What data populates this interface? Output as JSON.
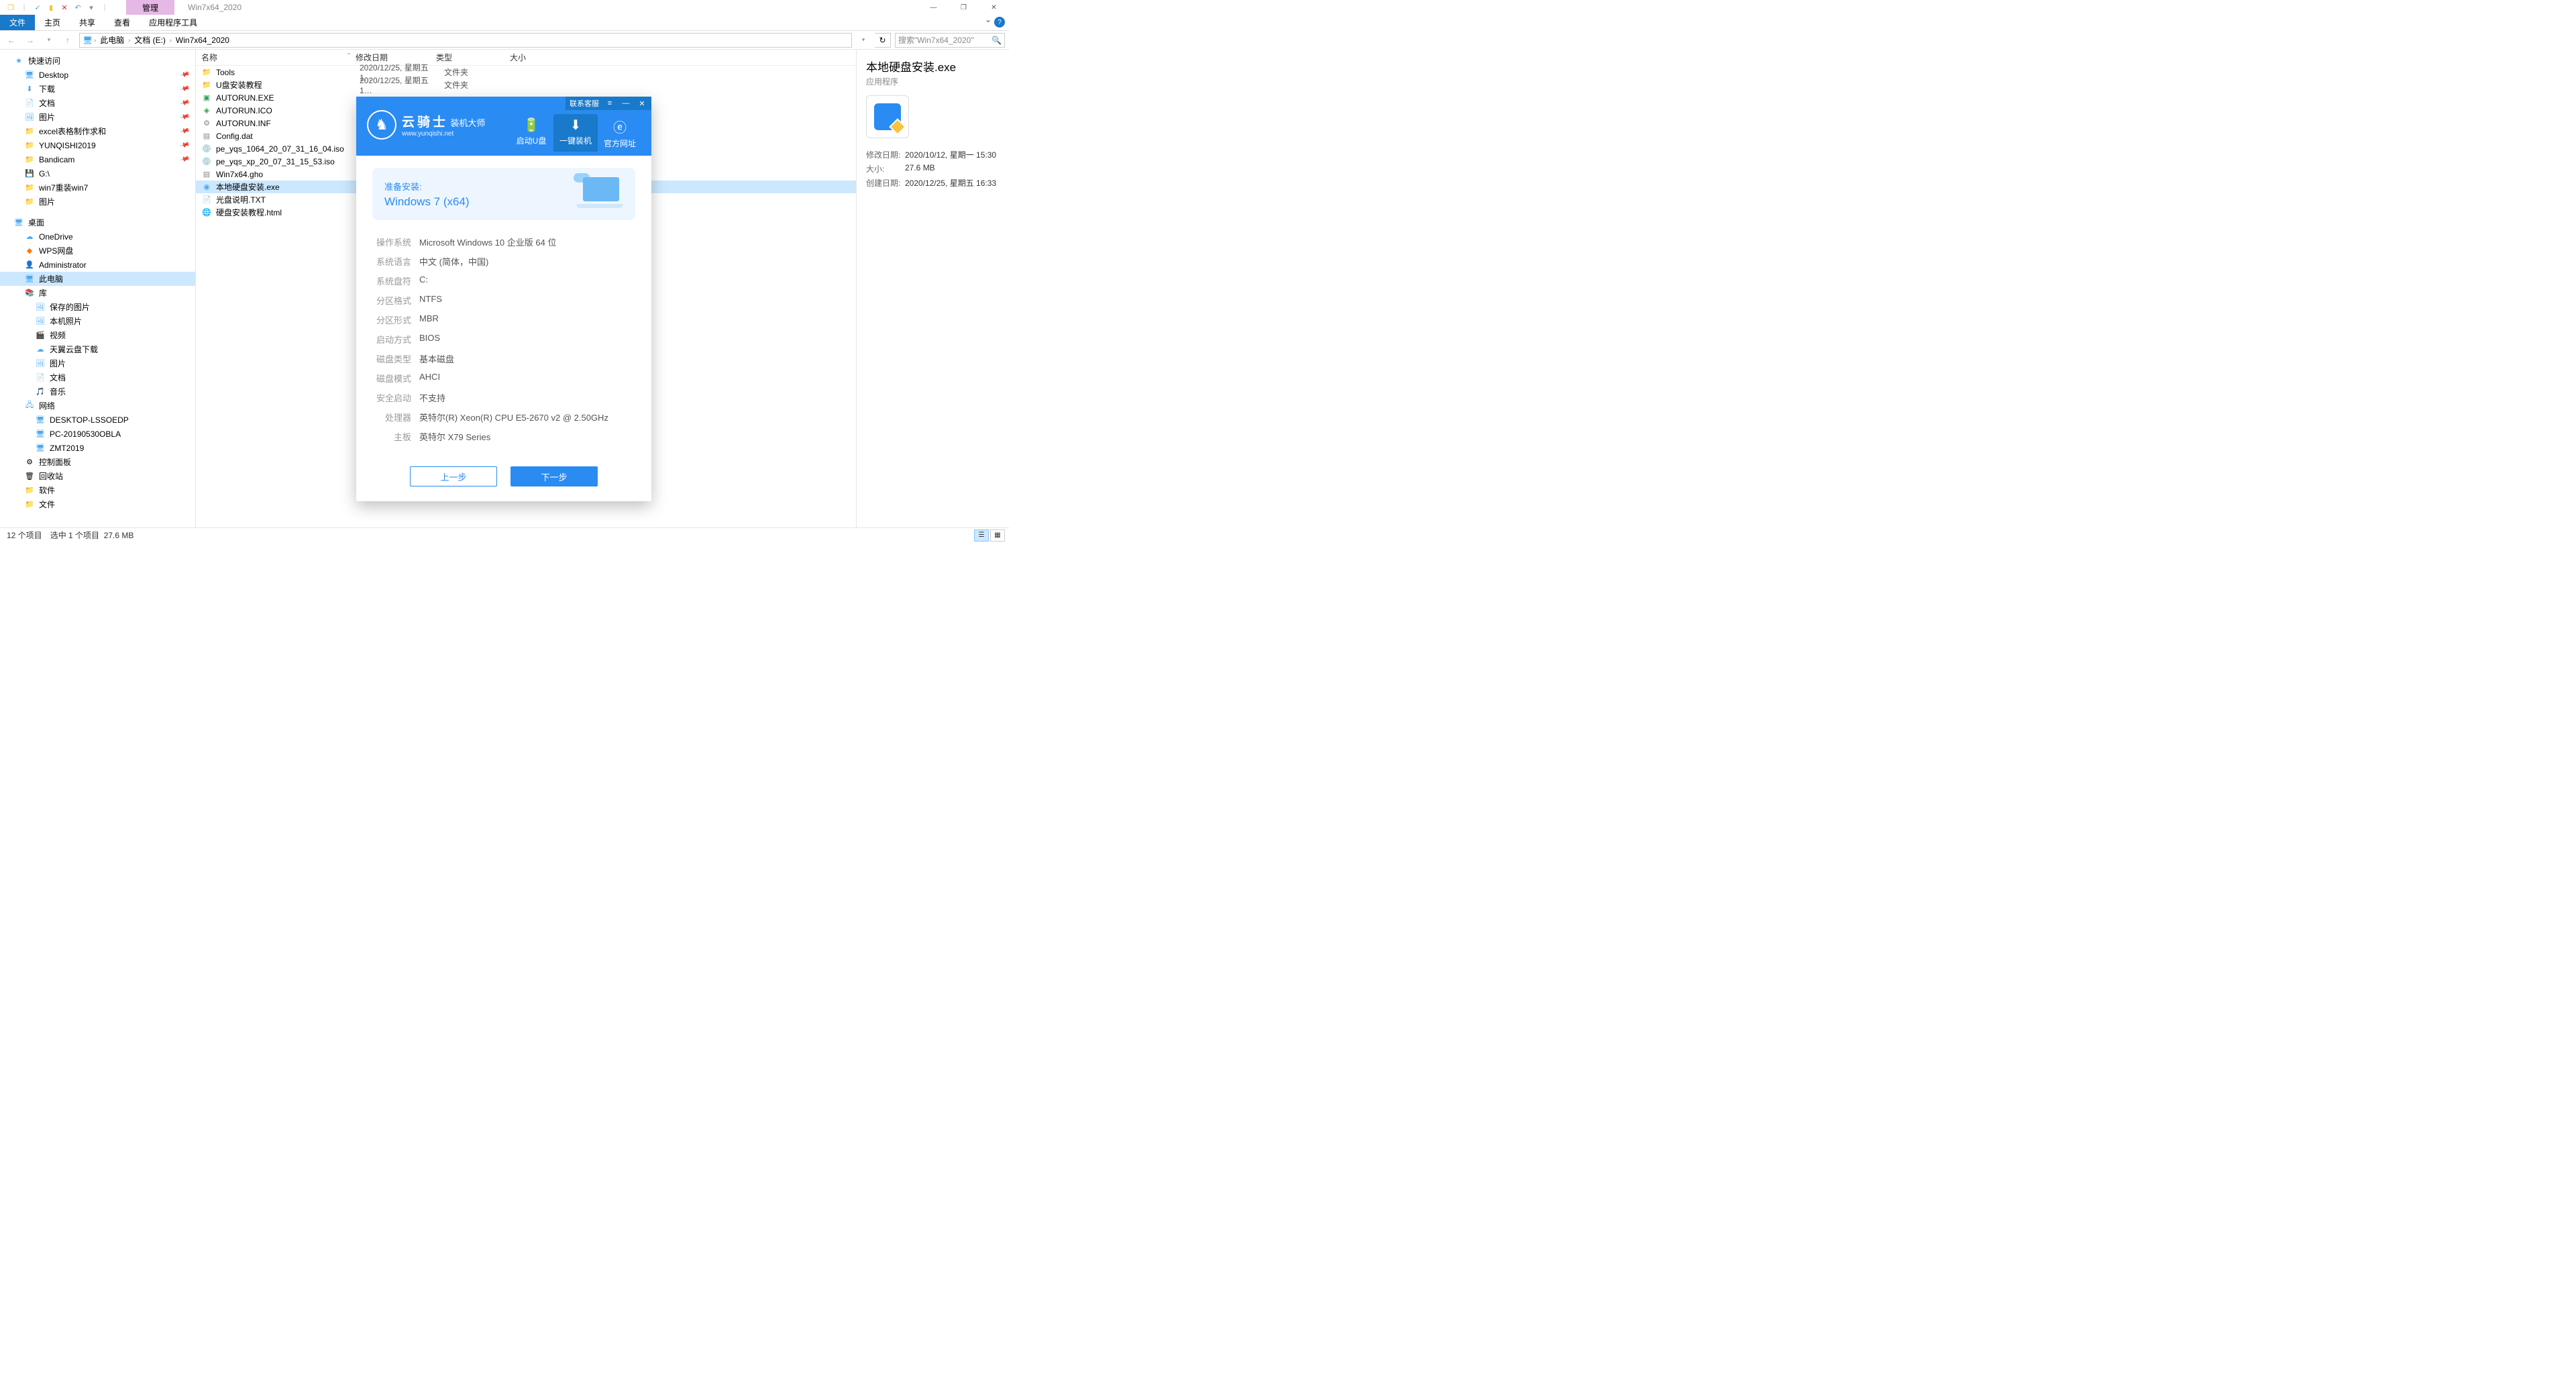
{
  "titlebar": {
    "manage_tab": "管理",
    "window_title": "Win7x64_2020"
  },
  "ribbon": {
    "file": "文件",
    "home": "主页",
    "share": "共享",
    "view": "查看",
    "apptools": "应用程序工具"
  },
  "breadcrumb": {
    "this_pc": "此电脑",
    "docs": "文档 (E:)",
    "folder": "Win7x64_2020"
  },
  "search": {
    "placeholder": "搜索\"Win7x64_2020\""
  },
  "sidebar": {
    "quick_access": "快速访问",
    "desktop": "Desktop",
    "downloads": "下载",
    "documents": "文档",
    "pictures": "图片",
    "excel": "excel表格制作求和",
    "yunqishi": "YUNQISHI2019",
    "bandicam": "Bandicam",
    "gdrive": "G:\\",
    "win7reinstall": "win7重装win7",
    "pictures2": "图片",
    "desktop_group": "桌面",
    "onedrive": "OneDrive",
    "wps": "WPS网盘",
    "admin": "Administrator",
    "this_pc": "此电脑",
    "libraries": "库",
    "saved_pictures": "保存的图片",
    "camera_roll": "本机照片",
    "videos": "视频",
    "tianyi": "天翼云盘下载",
    "pictures3": "图片",
    "documents2": "文档",
    "music": "音乐",
    "network": "网络",
    "pc1": "DESKTOP-LSSOEDP",
    "pc2": "PC-20190530OBLA",
    "pc3": "ZMT2019",
    "control_panel": "控制面板",
    "recycle": "回收站",
    "software": "软件",
    "documents3": "文件"
  },
  "columns": {
    "name": "名称",
    "date": "修改日期",
    "type": "类型",
    "size": "大小"
  },
  "files": [
    {
      "name": "Tools",
      "date": "2020/12/25, 星期五 1…",
      "type": "文件夹",
      "icon": "folder"
    },
    {
      "name": "U盘安装教程",
      "date": "2020/12/25, 星期五 1…",
      "type": "文件夹",
      "icon": "folder"
    },
    {
      "name": "AUTORUN.EXE",
      "date": "",
      "type": "",
      "icon": "exe-green"
    },
    {
      "name": "AUTORUN.ICO",
      "date": "",
      "type": "",
      "icon": "ico-green"
    },
    {
      "name": "AUTORUN.INF",
      "date": "",
      "type": "",
      "icon": "inf"
    },
    {
      "name": "Config.dat",
      "date": "",
      "type": "",
      "icon": "dat"
    },
    {
      "name": "pe_yqs_1064_20_07_31_16_04.iso",
      "date": "",
      "type": "",
      "icon": "iso"
    },
    {
      "name": "pe_yqs_xp_20_07_31_15_53.iso",
      "date": "",
      "type": "",
      "icon": "iso"
    },
    {
      "name": "Win7x64.gho",
      "date": "",
      "type": "",
      "icon": "gho"
    },
    {
      "name": "本地硬盘安装.exe",
      "date": "",
      "type": "",
      "icon": "exe-blue",
      "selected": true
    },
    {
      "name": "光盘说明.TXT",
      "date": "",
      "type": "",
      "icon": "txt"
    },
    {
      "name": "硬盘安装教程.html",
      "date": "",
      "type": "",
      "icon": "html"
    }
  ],
  "dialog": {
    "contact": "联系客服",
    "brand": "云骑士",
    "brand_suffix": "装机大师",
    "brand_url": "www.yunqishi.net",
    "tabs": {
      "usb": "启动U盘",
      "onekey": "一键装机",
      "web": "官方网址"
    },
    "prepare_title": "准备安装:",
    "prepare_os": "Windows 7 (x64)",
    "info": [
      {
        "label": "操作系统",
        "value": "Microsoft Windows 10 企业版 64 位"
      },
      {
        "label": "系统语言",
        "value": "中文 (简体，中国)"
      },
      {
        "label": "系统盘符",
        "value": "C:"
      },
      {
        "label": "分区格式",
        "value": "NTFS"
      },
      {
        "label": "分区形式",
        "value": "MBR"
      },
      {
        "label": "启动方式",
        "value": "BIOS"
      },
      {
        "label": "磁盘类型",
        "value": "基本磁盘"
      },
      {
        "label": "磁盘模式",
        "value": "AHCI"
      },
      {
        "label": "安全启动",
        "value": "不支持"
      },
      {
        "label": "处理器",
        "value": "英特尔(R) Xeon(R) CPU E5-2670 v2 @ 2.50GHz"
      },
      {
        "label": "主板",
        "value": "英特尔 X79 Series"
      }
    ],
    "prev": "上一步",
    "next": "下一步"
  },
  "details": {
    "filename": "本地硬盘安装.exe",
    "filetype": "应用程序",
    "mod_label": "修改日期:",
    "mod_value": "2020/10/12, 星期一 15:30",
    "size_label": "大小:",
    "size_value": "27.6 MB",
    "created_label": "创建日期:",
    "created_value": "2020/12/25, 星期五 16:33"
  },
  "statusbar": {
    "items": "12 个项目",
    "selected": "选中 1 个项目",
    "size": "27.6 MB"
  }
}
